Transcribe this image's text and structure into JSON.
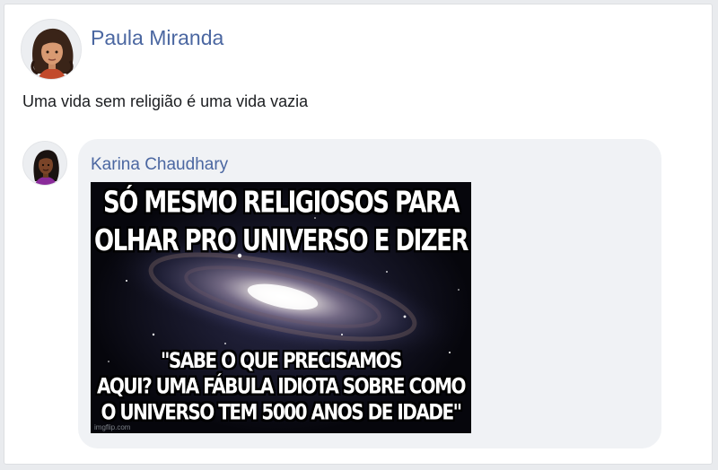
{
  "post": {
    "author": "Paula Miranda",
    "text": "Uma vida sem religião é uma vida vazia"
  },
  "comment": {
    "author": "Karina Chaudhary",
    "meme": {
      "top_text": "Só mesmo religiosos para\nolhar pro universo e dizer",
      "bottom_text": "\"Sabe o que precisamos\naqui? Uma fábula idiota sobre como\no universo tem 5000 anos de idade\"",
      "watermark": "imgflip.com",
      "image": "galaxy-image"
    }
  },
  "avatars": {
    "post_author": "avatar-woman-curly-hair",
    "comment_author": "avatar-woman-dark-hair"
  },
  "colors": {
    "author_link": "#4b67a1",
    "bubble": "#f0f2f5",
    "page_bg": "#e9ebee"
  }
}
